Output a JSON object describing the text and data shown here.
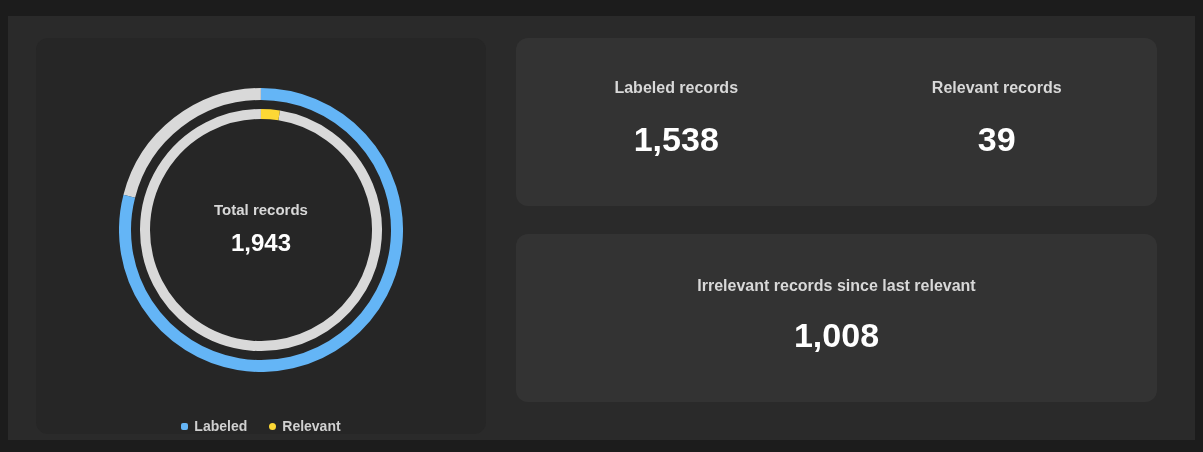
{
  "donut": {
    "center_label": "Total records",
    "center_value": "1,943",
    "rings": [
      {
        "color": "#64b5f6"
      },
      {
        "color": "#fdd835"
      }
    ]
  },
  "legend": [
    {
      "label": "Labeled",
      "color": "#64b5f6"
    },
    {
      "label": "Relevant",
      "color": "#fdd835"
    }
  ],
  "stats_top": [
    {
      "label": "Labeled records",
      "value": "1,538"
    },
    {
      "label": "Relevant records",
      "value": "39"
    }
  ],
  "stat_bottom": {
    "label": "Irrelevant records since last relevant",
    "value": "1,008"
  }
}
